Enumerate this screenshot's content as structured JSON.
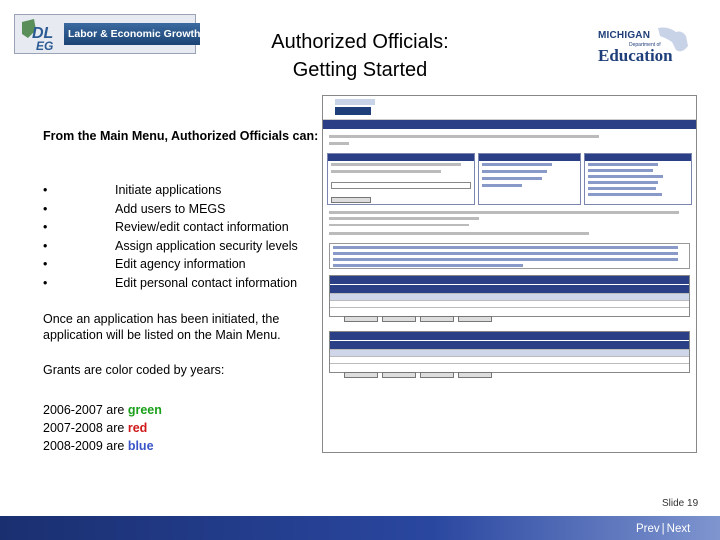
{
  "header": {
    "dleg_logo_text": "Labor & Economic Growth",
    "dleg_mark": "DLEG",
    "mde_logo": {
      "line1": "MICHIGAN",
      "line2": "Department of",
      "line3": "Education"
    },
    "title_line1": "Authorized Officials:",
    "title_line2": "Getting Started"
  },
  "body": {
    "intro": "From the Main Menu, Authorized Officials can:",
    "bullets": [
      "Initiate applications",
      "Add users to MEGS",
      "Review/edit contact information",
      "Assign application security levels",
      "Edit agency information",
      "Edit personal contact information"
    ],
    "para1": "Once an application has been initiated, the application will be listed on the Main Menu.",
    "para2": "Grants are color coded by years:",
    "years": [
      {
        "range": "2006-2007",
        "word": "are",
        "color_name": "green",
        "color": "#1aa01a"
      },
      {
        "range": "2007-2008",
        "word": "are",
        "color_name": "red",
        "color": "#d01818"
      },
      {
        "range": "2008-2009",
        "word": "are",
        "color_name": "blue",
        "color": "#3a55c8"
      }
    ]
  },
  "footer": {
    "slide_number": "Slide 19",
    "prev": "Prev",
    "separator": "|",
    "next": "Next"
  },
  "colors": {
    "accent_navy": "#2b3f86",
    "bottom_bar": "#1a2f70"
  }
}
